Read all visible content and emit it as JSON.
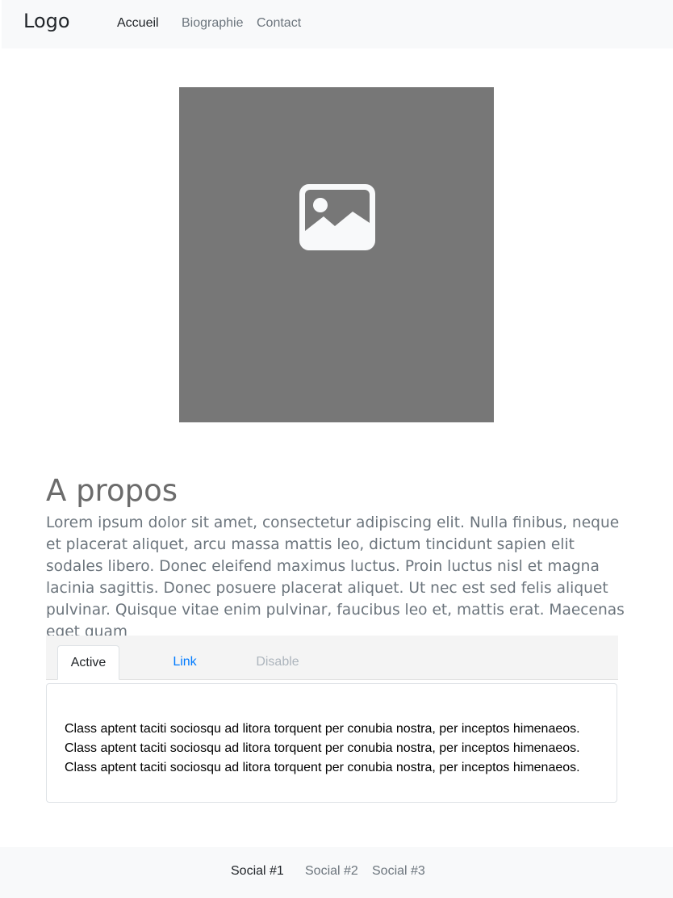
{
  "navbar": {
    "brand": "Logo",
    "links": [
      {
        "label": "Accueil",
        "active": true
      },
      {
        "label": "Biographie",
        "active": false
      },
      {
        "label": "Contact",
        "active": false
      }
    ]
  },
  "hero": {
    "icon": "image-icon",
    "background": "#777777"
  },
  "about": {
    "title": "A propos",
    "text": "Lorem ipsum dolor sit amet, consectetur adipiscing elit. Nulla finibus, neque et placerat aliquet, arcu massa mattis leo, dictum tincidunt sapien elit sodales libero. Donec eleifend maximus luctus. Proin luctus nisl et magna lacinia sagittis. Donec posuere placerat aliquet. Ut nec est sed felis aliquet pulvinar. Quisque vitae enim pulvinar, faucibus leo et, mattis erat. Maecenas eget quam"
  },
  "tabs": {
    "items": [
      {
        "label": "Active",
        "state": "active"
      },
      {
        "label": "Link",
        "state": "link"
      },
      {
        "label": "Disable",
        "state": "disabled"
      }
    ],
    "panel_lines": [
      "Class aptent taciti sociosqu ad litora torquent per conubia nostra, per inceptos himenaeos.",
      "Class aptent taciti sociosqu ad litora torquent per conubia nostra, per inceptos himenaeos.",
      "Class aptent taciti sociosqu ad litora torquent per conubia nostra, per inceptos himenaeos."
    ]
  },
  "footer": {
    "links": [
      {
        "label": "Social #1",
        "active": true
      },
      {
        "label": "Social #2",
        "active": false
      },
      {
        "label": "Social #3",
        "active": false
      }
    ]
  },
  "colors": {
    "link": "#007bff",
    "muted": "#6c757d",
    "disabled": "#adb5bd",
    "navbar_bg": "#f8f9fa"
  }
}
